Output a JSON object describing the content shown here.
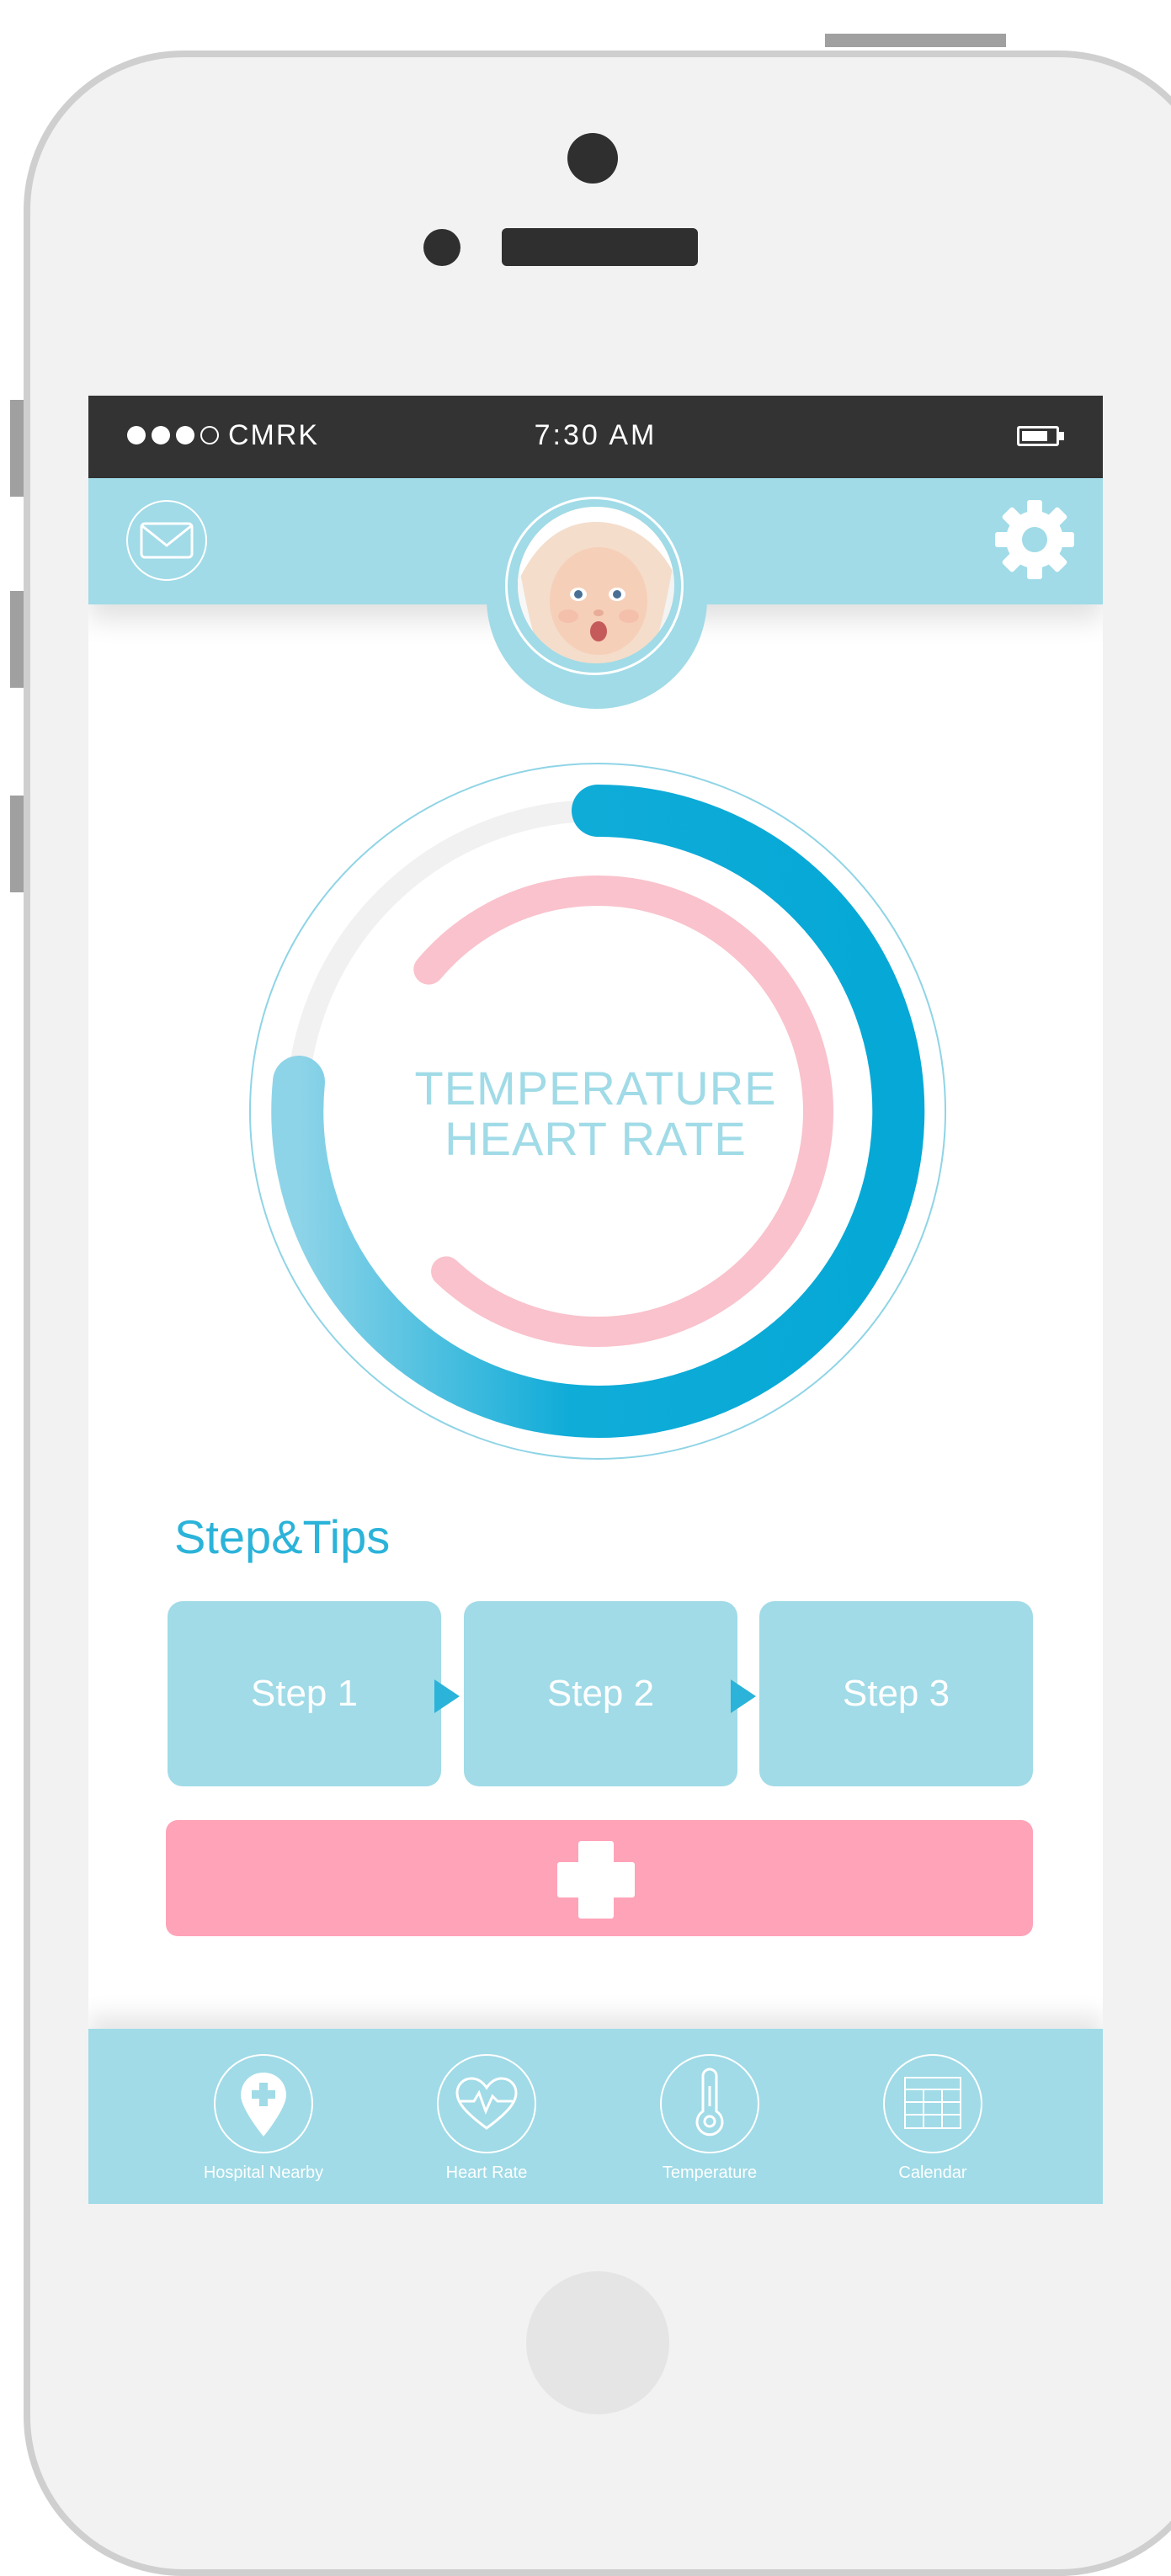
{
  "status_bar": {
    "carrier": "CMRK",
    "time": "7:30 AM"
  },
  "header": {
    "mail_icon": "mail-icon",
    "settings_icon": "gear-icon",
    "avatar": "baby-avatar"
  },
  "ring": {
    "line1": "TEMPERATURE",
    "line2": "HEART RATE",
    "outer_color": "#0aaad7",
    "inner_color": "#f9c2cc"
  },
  "tips": {
    "title": "Step&Tips",
    "steps": [
      "Step 1",
      "Step 2",
      "Step 3"
    ]
  },
  "add_button": {
    "icon": "plus-icon",
    "color": "#ffa3b8"
  },
  "tabs": [
    {
      "label": "Hospital Nearby",
      "icon": "hospital-pin-icon"
    },
    {
      "label": "Heart Rate",
      "icon": "heart-rate-icon"
    },
    {
      "label": "Temperature",
      "icon": "thermometer-icon"
    },
    {
      "label": "Calendar",
      "icon": "calendar-icon"
    }
  ],
  "colors": {
    "accent": "#a0dbe7",
    "blue": "#2bb3d9",
    "pink": "#ffa3b8",
    "dark": "#333333"
  }
}
